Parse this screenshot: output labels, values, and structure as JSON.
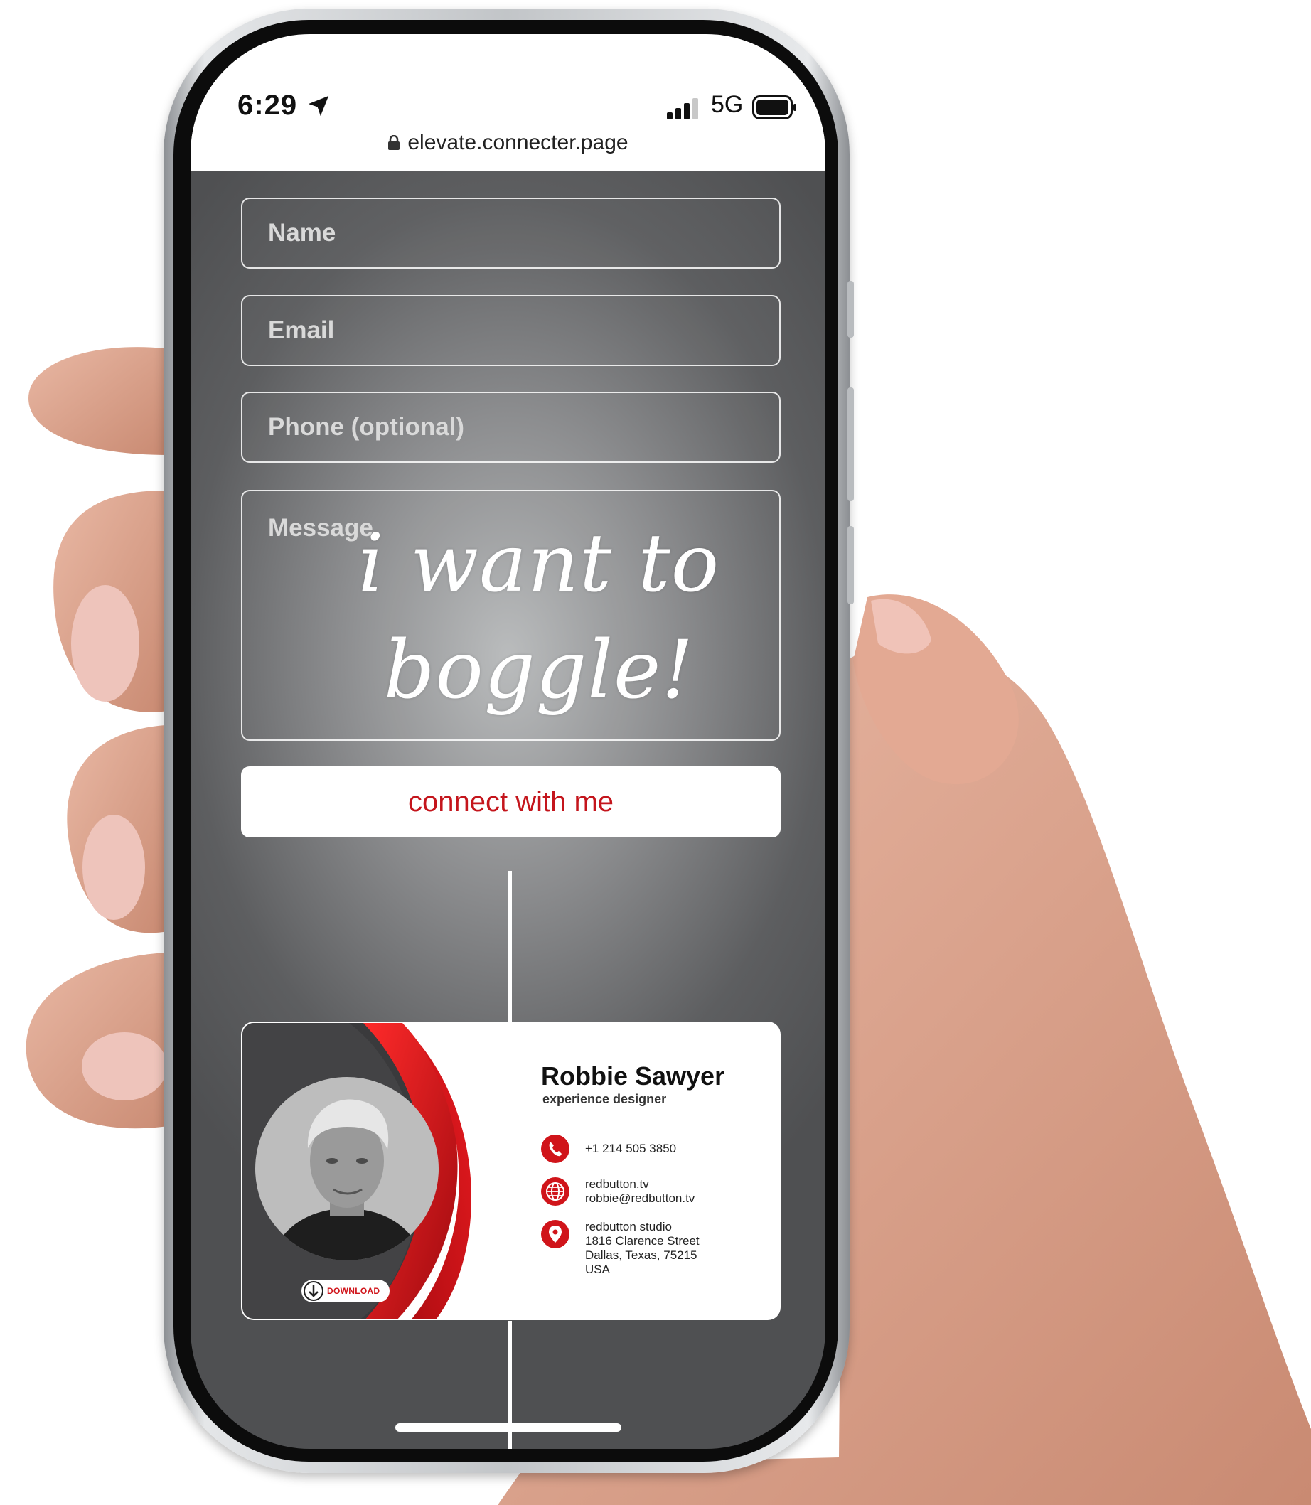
{
  "status_bar": {
    "time": "6:29",
    "network": "5G",
    "icons": [
      "location-arrow-icon",
      "signal-bars-icon",
      "battery-icon"
    ]
  },
  "browser": {
    "url": "elevate.connecter.page",
    "icon": "lock-icon"
  },
  "form": {
    "name_placeholder": "Name",
    "email_placeholder": "Email",
    "phone_placeholder": "Phone (optional)",
    "message_placeholder": "Message",
    "submit_label": "connect with me"
  },
  "overlay": {
    "handwriting_line1": "i want to",
    "handwriting_line2": "boggle!"
  },
  "card": {
    "name": "Robbie Sawyer",
    "title": "experience designer",
    "download_label": "DOWNLOAD",
    "phone": "+1 214 505 3850",
    "website": "redbutton.tv",
    "email": "robbie@redbutton.tv",
    "address": [
      "redbutton studio",
      "1816 Clarence Street",
      "Dallas, Texas, 75215",
      "USA"
    ],
    "accent_color": "#d0141a"
  },
  "colors": {
    "screen_bg": "#5d5e60",
    "button_text": "#c4151c",
    "card_dark": "#3c3c3e"
  }
}
